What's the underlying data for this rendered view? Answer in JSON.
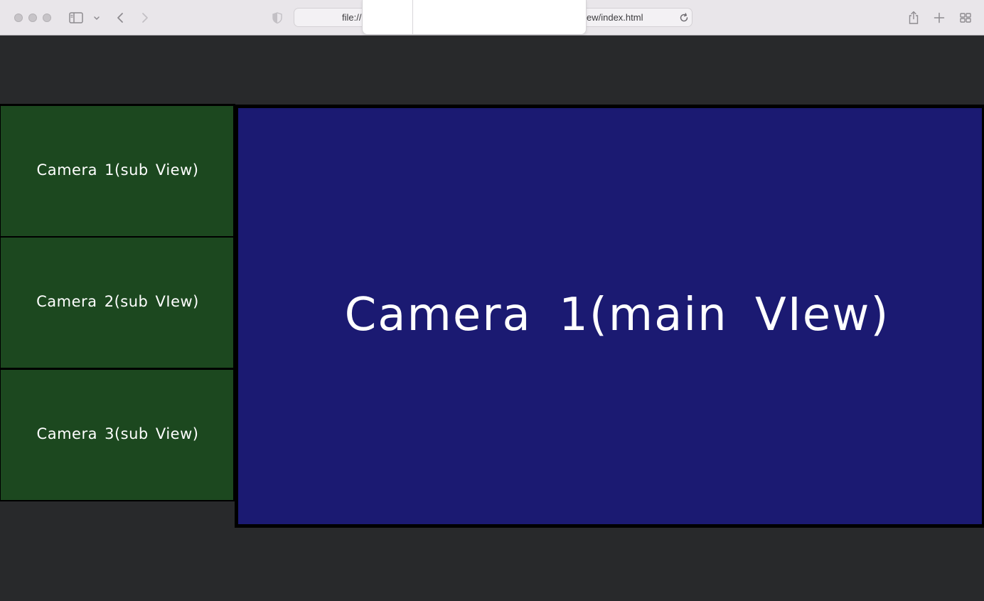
{
  "browser": {
    "url_visible_left": "file://",
    "url_visible_right": "ew/index.html"
  },
  "sub_views": [
    {
      "label": "Camera 1(sub View)"
    },
    {
      "label": "Camera 2(sub VIew)"
    },
    {
      "label": "Camera 3(sub View)"
    }
  ],
  "main_view": {
    "label": "Camera 1(main VIew)"
  },
  "colors": {
    "page_background": "#28292b",
    "sub_view_background": "#1c481f",
    "main_view_background": "#1b1a72",
    "border": "#000000",
    "text": "#ffffff"
  }
}
